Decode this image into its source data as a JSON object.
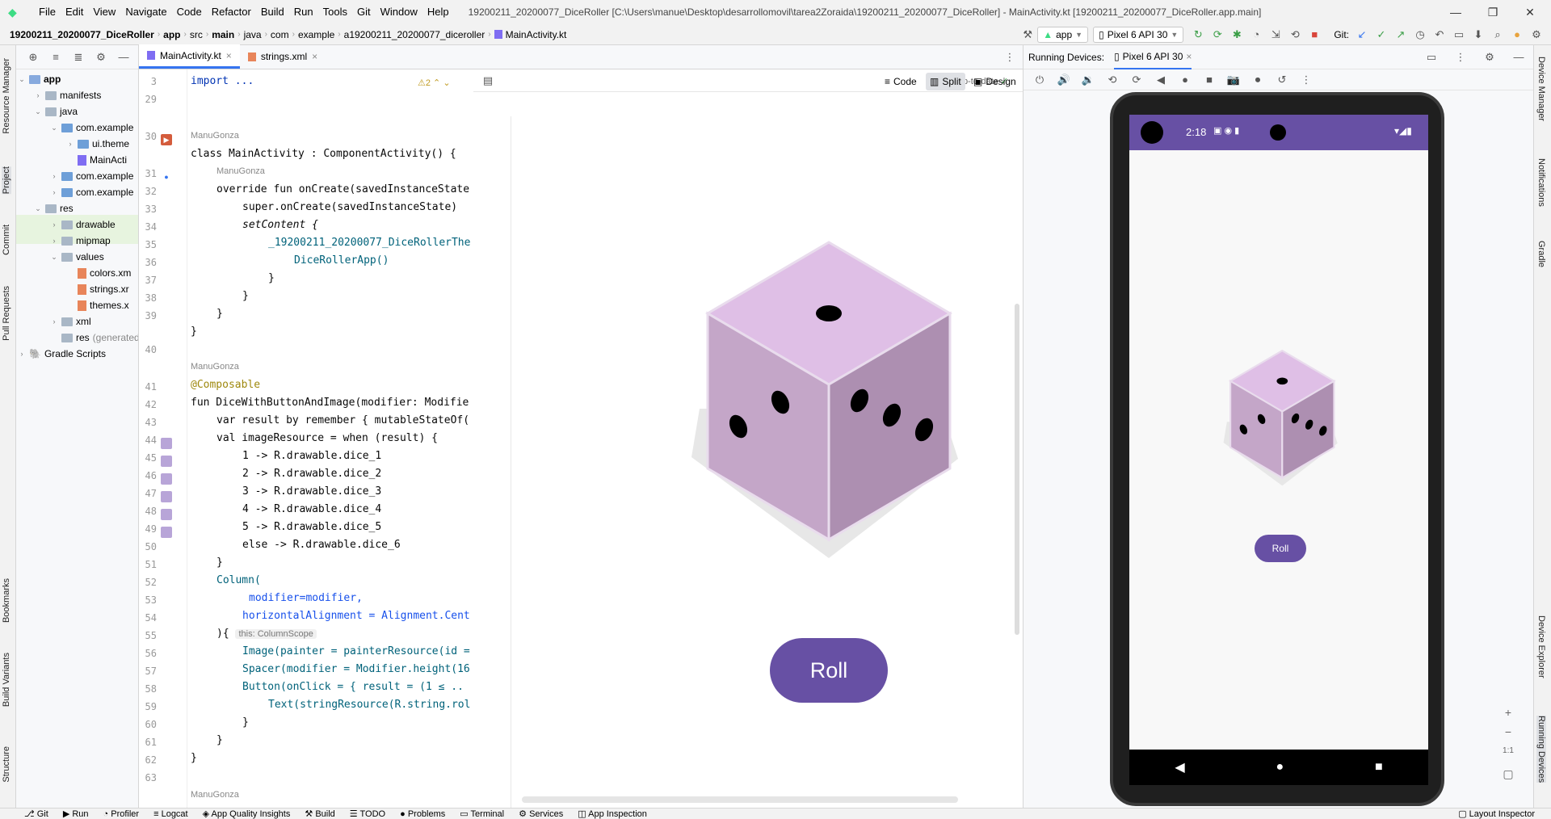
{
  "window": {
    "title": "19200211_20200077_DiceRoller [C:\\Users\\manue\\Desktop\\desarrollomovil\\tarea2Zoraida\\19200211_20200077_DiceRoller] - MainActivity.kt [19200211_20200077_DiceRoller.app.main]",
    "menu": [
      "File",
      "Edit",
      "View",
      "Navigate",
      "Code",
      "Refactor",
      "Build",
      "Run",
      "Tools",
      "Git",
      "Window",
      "Help"
    ]
  },
  "breadcrumb": [
    "19200211_20200077_DiceRoller",
    "app",
    "src",
    "main",
    "java",
    "com",
    "example",
    "a19200211_20200077_diceroller",
    "MainActivity.kt"
  ],
  "toolbar": {
    "run_config": "app",
    "device": "Pixel 6 API 30",
    "git_label": "Git:"
  },
  "left_strip": [
    "Resource Manager",
    "Project",
    "Commit",
    "Pull Requests",
    "Bookmarks",
    "Build Variants",
    "Structure"
  ],
  "right_strip": [
    "Device Manager",
    "Notifications",
    "Gradle",
    "Device Explorer",
    "Running Devices"
  ],
  "project_tree": [
    {
      "label": "app",
      "bold": true
    },
    {
      "label": "manifests"
    },
    {
      "label": "java"
    },
    {
      "label": "com.example"
    },
    {
      "label": "ui.theme"
    },
    {
      "label": "MainActi"
    },
    {
      "label": "com.example"
    },
    {
      "label": "com.example"
    },
    {
      "label": "res"
    },
    {
      "label": "drawable"
    },
    {
      "label": "mipmap"
    },
    {
      "label": "values"
    },
    {
      "label": "colors.xm"
    },
    {
      "label": "strings.xr"
    },
    {
      "label": "themes.x"
    },
    {
      "label": "xml"
    },
    {
      "label": "res",
      "suffix": "(generated)"
    },
    {
      "label": "Gradle Scripts"
    }
  ],
  "editor_tabs": [
    {
      "label": "MainActivity.kt",
      "active": true
    },
    {
      "label": "strings.xml",
      "active": false
    }
  ],
  "editor": {
    "warnings": "2",
    "author": "ManuGonza",
    "view_modes": [
      "Code",
      "Split",
      "Design"
    ],
    "status": "Up-to-date",
    "line_numbers": [
      "3",
      "29",
      "30",
      "31",
      "32",
      "33",
      "34",
      "35",
      "36",
      "37",
      "38",
      "39",
      "40",
      "41",
      "42",
      "43",
      "44",
      "45",
      "46",
      "47",
      "48",
      "49",
      "50",
      "51",
      "52",
      "53",
      "54",
      "55",
      "56",
      "57",
      "58",
      "59",
      "60",
      "61",
      "62",
      "63"
    ]
  },
  "code": {
    "l3": "import ...",
    "l30": "class MainActivity : ComponentActivity() {",
    "l31": "override fun onCreate(savedInstanceState",
    "l32": "super.onCreate(savedInstanceState)",
    "l33": "setContent {",
    "l34": "_19200211_20200077_DiceRollerThe",
    "l35": "DiceRollerApp()",
    "l36": "}",
    "l37": "}",
    "l38": "}",
    "l39": "}",
    "l41": "@Composable",
    "l42": "fun DiceWithButtonAndImage(modifier: Modifie",
    "l43": "var result by remember { mutableStateOf(",
    "l44": "val imageResource = when (result) {",
    "l45": "1 -> R.drawable.dice_1",
    "l46": "2 -> R.drawable.dice_2",
    "l47": "3 -> R.drawable.dice_3",
    "l48": "4 -> R.drawable.dice_4",
    "l49": "5 -> R.drawable.dice_5",
    "l50": "else -> R.drawable.dice_6",
    "l51": "}",
    "l52": "Column(",
    "l53": "modifier=modifier,",
    "l54": "horizontalAlignment = Alignment.Cent",
    "l55": "){",
    "l55hint": "this: ColumnScope",
    "l56": "Image(painter = painterResource(id =",
    "l57": "Spacer(modifier = Modifier.height(16",
    "l58": "Button(onClick = { result = (1 ≤ ..",
    "l59": "Text(stringResource(R.string.rol",
    "l60": "}",
    "l61": "}",
    "l62": "}"
  },
  "preview": {
    "button_label": "Roll"
  },
  "running_devices": {
    "title": "Running Devices:",
    "tab": "Pixel 6 API 30",
    "time": "2:18",
    "button_label": "Roll",
    "zoom_label": "1:1"
  },
  "bottom_tabs": [
    "Git",
    "Run",
    "Profiler",
    "Logcat",
    "App Quality Insights",
    "Build",
    "TODO",
    "Problems",
    "Terminal",
    "Services",
    "App Inspection"
  ],
  "bottom_right": "Layout Inspector",
  "colors": {
    "accent": "#3574f0",
    "app_primary": "#6750a4",
    "dice_top": "#dfbfe6",
    "dice_left": "#c4a6c8",
    "dice_right": "#ad8fb1"
  }
}
